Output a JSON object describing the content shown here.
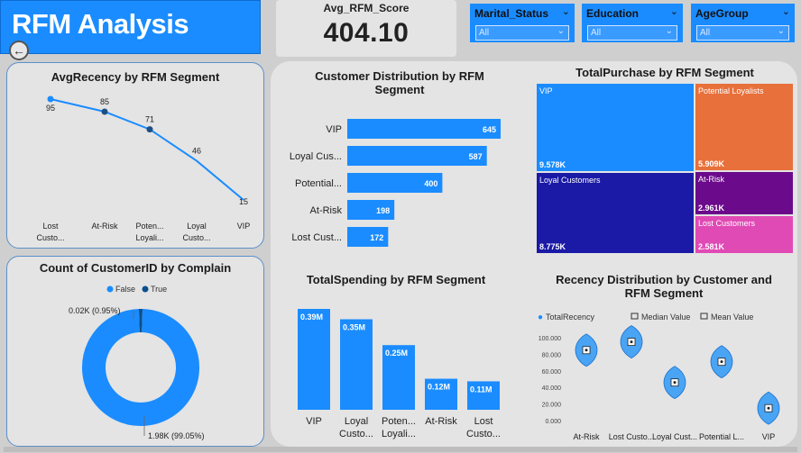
{
  "header": {
    "title": "RFM Analysis",
    "back_icon": "back-arrow-icon"
  },
  "kpi": {
    "label": "Avg_RFM_Score",
    "value": "404.10"
  },
  "slicers": [
    {
      "name": "Marital_Status",
      "value": "All"
    },
    {
      "name": "Education",
      "value": "All"
    },
    {
      "name": "AgeGroup",
      "value": "All"
    }
  ],
  "colors": {
    "accent": "#1a8cff",
    "dark_blue": "#1a1aa6",
    "orange": "#e8703a",
    "purple": "#6b0a8a",
    "pink": "#e04ab5"
  },
  "recency_chart": {
    "title": "AvgRecency by RFM Segment"
  },
  "complain_chart": {
    "title": "Count of CustomerID by Complain",
    "legend_false": "False",
    "legend_true": "True"
  },
  "distribution_chart": {
    "title_line1": "Customer Distribution by RFM",
    "title_line2": "Segment"
  },
  "purchase_chart": {
    "title": "TotalPurchase by RFM Segment"
  },
  "spending_chart": {
    "title": "TotalSpending by RFM Segment"
  },
  "violin_chart": {
    "title_line1": "Recency Distribution by Customer and",
    "title_line2": "RFM Segment",
    "legend_total": "TotalRecency",
    "legend_median": "Median Value",
    "legend_mean": "Mean Value"
  },
  "chart_data": [
    {
      "type": "line",
      "title": "AvgRecency by RFM Segment",
      "categories": [
        "Lost Custo...",
        "At-Risk",
        "Poten... Loyali...",
        "Loyal Custo...",
        "VIP"
      ],
      "values": [
        95,
        85,
        71,
        46,
        15
      ]
    },
    {
      "type": "pie",
      "title": "Count of CustomerID by Complain",
      "categories": [
        "False",
        "True"
      ],
      "values": [
        1980,
        20
      ],
      "labels": [
        "1.98K (99.05%)",
        "0.02K (0.95%)"
      ]
    },
    {
      "type": "bar",
      "title": "Customer Distribution by RFM Segment",
      "categories": [
        "VIP",
        "Loyal Cus...",
        "Potential...",
        "At-Risk",
        "Lost Cust..."
      ],
      "values": [
        645,
        587,
        400,
        198,
        172
      ]
    },
    {
      "type": "heatmap",
      "title": "TotalPurchase by RFM Segment",
      "categories": [
        "VIP",
        "Loyal Customers",
        "Potential Loyalists",
        "At-Risk",
        "Lost Customers"
      ],
      "values": [
        9578,
        8775,
        5909,
        2961,
        2581
      ],
      "labels": [
        "9.578K",
        "8.775K",
        "5.909K",
        "2.961K",
        "2.581K"
      ]
    },
    {
      "type": "bar",
      "title": "TotalSpending by RFM Segment",
      "categories": [
        "VIP",
        "Loyal Custo...",
        "Poten... Loyali...",
        "At-Risk",
        "Lost Custo..."
      ],
      "values": [
        0.39,
        0.35,
        0.25,
        0.12,
        0.11
      ],
      "labels": [
        "0.39M",
        "0.35M",
        "0.25M",
        "0.12M",
        "0.11M"
      ]
    },
    {
      "type": "scatter",
      "title": "Recency Distribution by Customer and RFM Segment",
      "categories": [
        "At-Risk",
        "Lost Custo...",
        "Loyal Cust...",
        "Potential L...",
        "VIP"
      ],
      "values": [
        85,
        95,
        46,
        71,
        15
      ],
      "ylim": [
        0,
        100
      ],
      "yticks": [
        "100.000",
        "80.000",
        "60.000",
        "40.000",
        "20.000",
        "0.000"
      ]
    }
  ]
}
